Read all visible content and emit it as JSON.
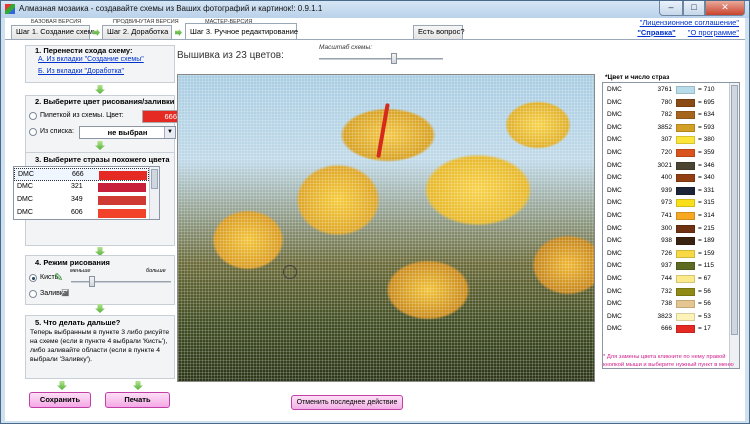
{
  "window": {
    "title": "Алмазная мозаика - создавайте схемы из Ваших фотографий и картинок!: 0.9.1.1",
    "min_glyph": "–",
    "max_glyph": "□",
    "close_glyph": "✕"
  },
  "steps": {
    "caption1": "БАЗОВАЯ ВЕРСИЯ",
    "caption2": "ПРОДВИНУТАЯ ВЕРСИЯ",
    "caption3": "МАСТЕР-ВЕРСИЯ",
    "tab1": "Шаг 1. Создание схемы",
    "tab2": "Шаг 2. Доработка",
    "tab3": "Шаг 3. Ручное редактирование",
    "question_tab": "Есть вопрос?"
  },
  "top_links": {
    "license": "\"Лицензионное соглашение\"",
    "help": "\"Справка\"",
    "about": "\"О программе\""
  },
  "section1": {
    "title": "1. Перенести схода схему:",
    "link_a": "А. Из вкладки \"Создание схемы\"",
    "link_b": "Б. Из вкладки \"Доработка\""
  },
  "section2": {
    "title": "2. Выберите цвет рисования/заливки",
    "pipette_label": "Пипеткой из схемы. Цвет:",
    "color_code": "666",
    "from_list_label": "Из списка:",
    "combo_value": "не выбран",
    "combo_arrow": "▼"
  },
  "section3": {
    "title": "3. Выберите стразы похожего цвета",
    "rows": [
      {
        "maker": "DMC",
        "code": "666",
        "color": "#e52a24"
      },
      {
        "maker": "DMC",
        "code": "321",
        "color": "#c8203a"
      },
      {
        "maker": "DMC",
        "code": "349",
        "color": "#cf3a32"
      },
      {
        "maker": "DMC",
        "code": "606",
        "color": "#f0432a"
      }
    ]
  },
  "section4": {
    "title": "4. Режим рисования",
    "brush_label": "Кисть",
    "fill_label": "Заливка",
    "less_label": "меньше",
    "more_label": "больше"
  },
  "section5": {
    "title": "5. Что делать дальше?",
    "text": "Теперь выбранным в пункте 3 либо рисуйте на схеме (если в пункте 4 выбрали 'Кисть'), либо заливайте области (если в пункте 4 выбрали 'Заливку')."
  },
  "buttons": {
    "save": "Сохранить",
    "print": "Печать",
    "undo": "Отменить последнее действие"
  },
  "canvas": {
    "title": "Вышивка из 23 цветов:",
    "scale_label": "Масштаб схемы:"
  },
  "legend": {
    "title": "*Цвет и число страз",
    "rows": [
      {
        "maker": "DMC",
        "code": "3761",
        "color": "#b8dcea",
        "count": "= 710"
      },
      {
        "maker": "DMC",
        "code": "780",
        "color": "#8a4a14",
        "count": "= 695"
      },
      {
        "maker": "DMC",
        "code": "782",
        "color": "#a5651c",
        "count": "= 634"
      },
      {
        "maker": "DMC",
        "code": "3852",
        "color": "#d39f24",
        "count": "= 593"
      },
      {
        "maker": "DMC",
        "code": "307",
        "color": "#fbe53a",
        "count": "= 380"
      },
      {
        "maker": "DMC",
        "code": "720",
        "color": "#d9541c",
        "count": "= 359"
      },
      {
        "maker": "DMC",
        "code": "3021",
        "color": "#4a4433",
        "count": "= 346"
      },
      {
        "maker": "DMC",
        "code": "400",
        "color": "#923f14",
        "count": "= 340"
      },
      {
        "maker": "DMC",
        "code": "939",
        "color": "#1c2438",
        "count": "= 331"
      },
      {
        "maker": "DMC",
        "code": "973",
        "color": "#f9de1a",
        "count": "= 315"
      },
      {
        "maker": "DMC",
        "code": "741",
        "color": "#f7a720",
        "count": "= 314"
      },
      {
        "maker": "DMC",
        "code": "300",
        "color": "#6e3212",
        "count": "= 215"
      },
      {
        "maker": "DMC",
        "code": "938",
        "color": "#3a2210",
        "count": "= 189"
      },
      {
        "maker": "DMC",
        "code": "726",
        "color": "#f8d844",
        "count": "= 159"
      },
      {
        "maker": "DMC",
        "code": "937",
        "color": "#5c6a22",
        "count": "= 115"
      },
      {
        "maker": "DMC",
        "code": "744",
        "color": "#fbe98a",
        "count": "= 67"
      },
      {
        "maker": "DMC",
        "code": "732",
        "color": "#8e8a14",
        "count": "= 56"
      },
      {
        "maker": "DMC",
        "code": "738",
        "color": "#e6c690",
        "count": "= 56"
      },
      {
        "maker": "DMC",
        "code": "3823",
        "color": "#fdf3b8",
        "count": "= 53"
      },
      {
        "maker": "DMC",
        "code": "666",
        "color": "#e52a24",
        "count": "= 17"
      }
    ],
    "note": "* Для замены цвета кликните по нему правой кнопкой мыши и выберите нужный пункт в меню"
  },
  "colors": {
    "accent_pink": "#f5a8e6",
    "link_blue": "#0033cc",
    "note_pink": "#d0208c"
  }
}
